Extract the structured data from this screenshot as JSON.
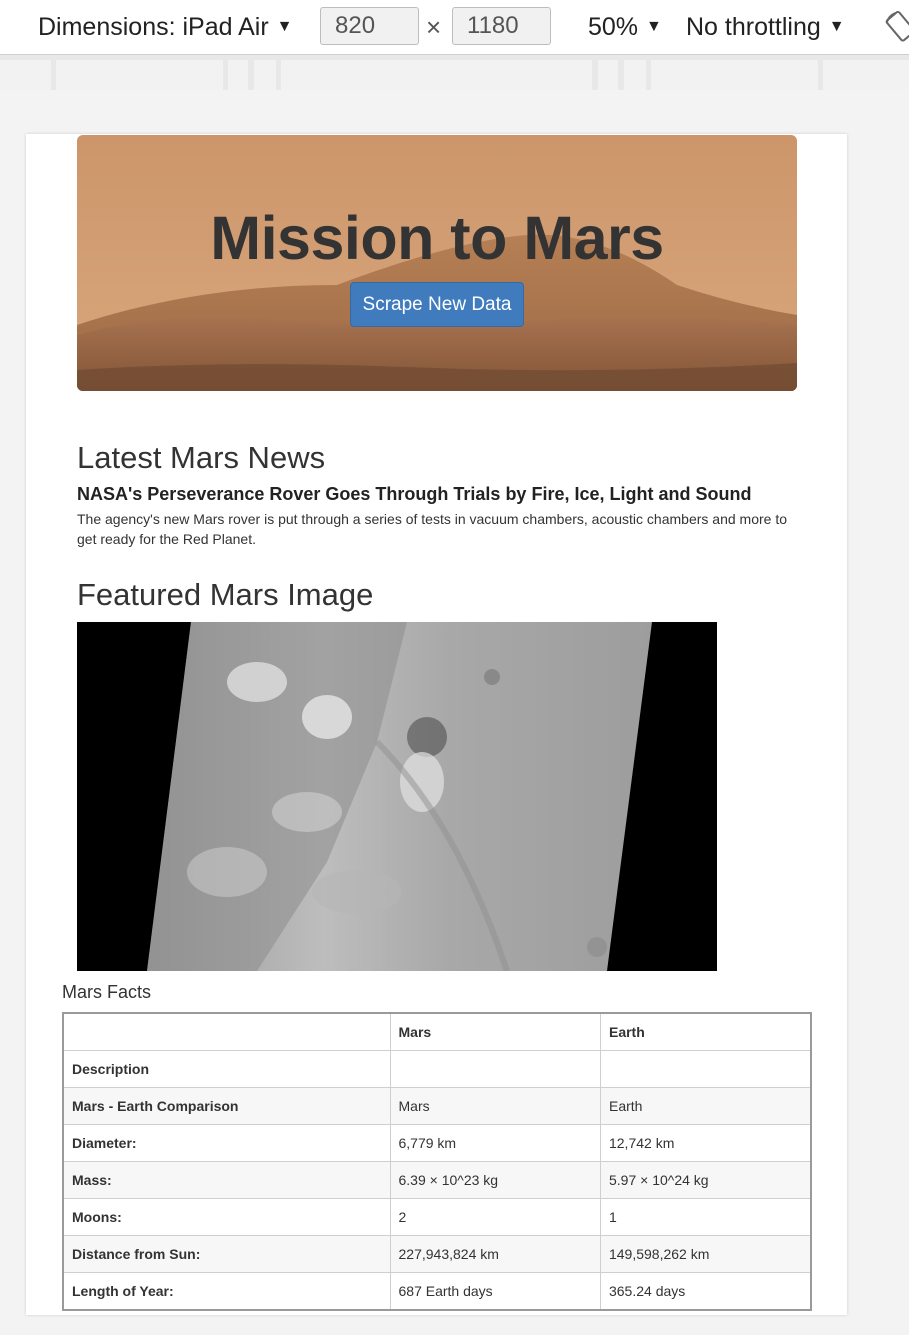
{
  "devtools": {
    "device_label": "Dimensions: iPad Air",
    "width_value": "820",
    "times_symbol": "×",
    "height_value": "1180",
    "zoom_label": "50%",
    "throttling_label": "No throttling",
    "caret": "▼"
  },
  "jumbotron": {
    "title": "Mission to Mars",
    "button_label": "Scrape New Data"
  },
  "news": {
    "heading": "Latest Mars News",
    "title": "NASA's Perseverance Rover Goes Through Trials by Fire, Ice, Light and Sound",
    "paragraph": "The agency's new Mars rover is put through a series of tests in vacuum chambers, acoustic chambers and more to get ready for the Red Planet."
  },
  "featured": {
    "heading": "Featured Mars Image"
  },
  "facts": {
    "caption": "Mars Facts",
    "headers": [
      "",
      "Mars",
      "Earth"
    ],
    "rows": [
      [
        "Description",
        "",
        ""
      ],
      [
        "Mars - Earth Comparison",
        "Mars",
        "Earth"
      ],
      [
        "Diameter:",
        "6,779 km",
        "12,742 km"
      ],
      [
        "Mass:",
        "6.39 × 10^23 kg",
        "5.97 × 10^24 kg"
      ],
      [
        "Moons:",
        "2",
        "1"
      ],
      [
        "Distance from Sun:",
        "227,943,824 km",
        "149,598,262 km"
      ],
      [
        "Length of Year:",
        "687 Earth days",
        "365.24 days"
      ]
    ]
  },
  "colors": {
    "button": "#3f7bbd",
    "sky": "#c99468",
    "ground": "#a8714a"
  }
}
